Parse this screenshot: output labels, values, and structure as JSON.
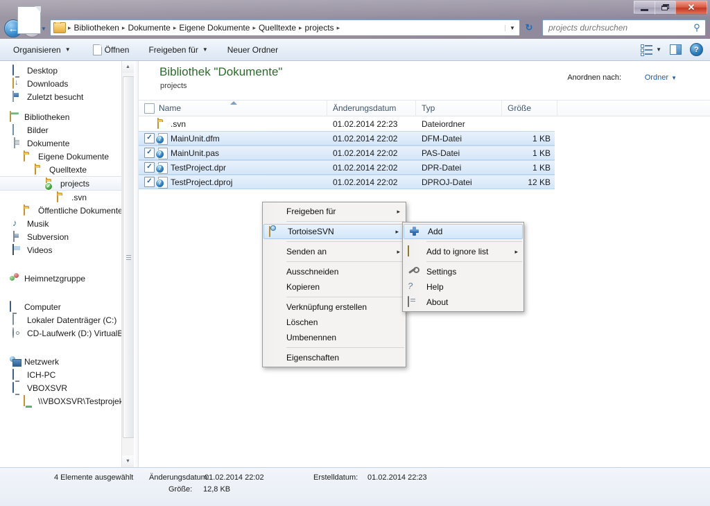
{
  "window": {
    "minimize_label": "Minimieren",
    "maximize_label": "Maximieren",
    "close_label": "Schließen"
  },
  "nav": {
    "back_glyph": "←",
    "forward_glyph": "→",
    "recent_caret": "▼",
    "breadcrumbs": [
      "Bibliotheken",
      "Dokumente",
      "Eigene Dokumente",
      "Quelltexte",
      "projects"
    ],
    "separator": "▸",
    "address_caret": "▼",
    "refresh_glyph": "↻"
  },
  "search": {
    "placeholder": "projects durchsuchen",
    "value": "",
    "icon_glyph": "⚲"
  },
  "toolbar": {
    "organize_label": "Organisieren",
    "open_label": "Öffnen",
    "share_label": "Freigeben für",
    "newfolder_label": "Neuer Ordner",
    "caret": "▼",
    "help_glyph": "?"
  },
  "sidebar": {
    "items": [
      {
        "label": "Desktop",
        "icon": "monitor-icon",
        "indent": 1
      },
      {
        "label": "Downloads",
        "icon": "downloads-icon",
        "indent": 1
      },
      {
        "label": "Zuletzt besucht",
        "icon": "recent-places-icon",
        "indent": 1
      },
      {
        "label": "Bibliotheken",
        "icon": "libraries-icon",
        "indent": 0
      },
      {
        "label": "Bilder",
        "icon": "pictures-icon",
        "indent": 1
      },
      {
        "label": "Dokumente",
        "icon": "documents-icon",
        "indent": 1
      },
      {
        "label": "Eigene Dokumente",
        "icon": "folder-icon",
        "indent": 2
      },
      {
        "label": "Quelltexte",
        "icon": "folder-icon",
        "indent": 3
      },
      {
        "label": "projects",
        "icon": "folder-svn-versioned-icon",
        "indent": 4,
        "selected": true
      },
      {
        "label": ".svn",
        "icon": "folder-icon",
        "indent": 5
      },
      {
        "label": "Öffentliche Dokumente",
        "icon": "folder-icon",
        "indent": 2
      },
      {
        "label": "Musik",
        "icon": "music-icon",
        "indent": 1
      },
      {
        "label": "Subversion",
        "icon": "subversion-icon",
        "indent": 1
      },
      {
        "label": "Videos",
        "icon": "videos-icon",
        "indent": 1
      },
      {
        "label": "Heimnetzgruppe",
        "icon": "homegroup-icon",
        "indent": 0
      },
      {
        "label": "Computer",
        "icon": "computer-icon",
        "indent": 0
      },
      {
        "label": "Lokaler Datenträger (C:)",
        "icon": "harddisk-icon",
        "indent": 1
      },
      {
        "label": "CD-Laufwerk (D:) VirtualBo",
        "icon": "cdrom-icon",
        "indent": 1
      },
      {
        "label": "Netzwerk",
        "icon": "network-icon",
        "indent": 0
      },
      {
        "label": "ICH-PC",
        "icon": "computer-icon",
        "indent": 1
      },
      {
        "label": "VBOXSVR",
        "icon": "computer-icon",
        "indent": 1
      },
      {
        "label": "\\\\VBOXSVR\\Testprojekt",
        "icon": "network-share-icon",
        "indent": 2
      }
    ]
  },
  "library": {
    "title": "Bibliothek \"Dokumente\"",
    "subtitle": "projects",
    "arrange_label": "Anordnen nach:",
    "arrange_value": "Ordner",
    "arrange_caret": "▼"
  },
  "columns": {
    "name": "Name",
    "date": "Änderungsdatum",
    "type": "Typ",
    "size": "Größe"
  },
  "files": [
    {
      "name": ".svn",
      "date": "01.02.2014 22:23",
      "type": "Dateiordner",
      "size": "",
      "icon": "folder-icon",
      "selected": false,
      "checked": false,
      "overlay": ""
    },
    {
      "name": "MainUnit.dfm",
      "date": "01.02.2014 22:02",
      "type": "DFM-Datei",
      "size": "1 KB",
      "icon": "file-icon",
      "selected": true,
      "checked": true,
      "overlay": "svn-unversioned-icon"
    },
    {
      "name": "MainUnit.pas",
      "date": "01.02.2014 22:02",
      "type": "PAS-Datei",
      "size": "1 KB",
      "icon": "file-icon",
      "selected": true,
      "checked": true,
      "overlay": "svn-unversioned-icon"
    },
    {
      "name": "TestProject.dpr",
      "date": "01.02.2014 22:02",
      "type": "DPR-Datei",
      "size": "1 KB",
      "icon": "file-icon",
      "selected": true,
      "checked": true,
      "overlay": "svn-unversioned-icon"
    },
    {
      "name": "TestProject.dproj",
      "date": "01.02.2014 22:02",
      "type": "DPROJ-Datei",
      "size": "12 KB",
      "icon": "file-icon",
      "selected": true,
      "checked": true,
      "overlay": "svn-unversioned-icon"
    }
  ],
  "context_menu": {
    "items": [
      {
        "label": "Freigeben für",
        "submenu": true,
        "icon": "",
        "highlighted": false,
        "divider_after": true
      },
      {
        "label": "TortoiseSVN",
        "submenu": true,
        "icon": "tortoisesvn-icon",
        "highlighted": true,
        "divider_after": true
      },
      {
        "label": "Senden an",
        "submenu": true,
        "icon": "",
        "highlighted": false,
        "divider_after": true
      },
      {
        "label": "Ausschneiden",
        "submenu": false,
        "icon": "",
        "highlighted": false,
        "divider_after": false
      },
      {
        "label": "Kopieren",
        "submenu": false,
        "icon": "",
        "highlighted": false,
        "divider_after": true
      },
      {
        "label": "Verknüpfung erstellen",
        "submenu": false,
        "icon": "",
        "highlighted": false,
        "divider_after": false
      },
      {
        "label": "Löschen",
        "submenu": false,
        "icon": "",
        "highlighted": false,
        "divider_after": false
      },
      {
        "label": "Umbenennen",
        "submenu": false,
        "icon": "",
        "highlighted": false,
        "divider_after": true
      },
      {
        "label": "Eigenschaften",
        "submenu": false,
        "icon": "",
        "highlighted": false,
        "divider_after": false
      }
    ],
    "arrow": "▸"
  },
  "submenu": {
    "items": [
      {
        "label": "Add",
        "submenu": false,
        "icon": "add-icon",
        "highlighted": true,
        "divider_after": true
      },
      {
        "label": "Add to ignore list",
        "submenu": true,
        "icon": "ignore-icon",
        "highlighted": false,
        "divider_after": true
      },
      {
        "label": "Settings",
        "submenu": false,
        "icon": "settings-icon",
        "highlighted": false,
        "divider_after": false
      },
      {
        "label": "Help",
        "submenu": false,
        "icon": "help-icon",
        "highlighted": false,
        "divider_after": false
      },
      {
        "label": "About",
        "submenu": false,
        "icon": "about-icon",
        "highlighted": false,
        "divider_after": false
      }
    ],
    "arrow": "▸"
  },
  "statusbar": {
    "count": "4 Elemente ausgewählt",
    "modified_label": "Änderungsdatum:",
    "modified_value": "01.02.2014 22:02",
    "created_label": "Erstelldatum:",
    "created_value": "01.02.2014 22:23",
    "size_label": "Größe:",
    "size_value": "12,8 KB"
  },
  "colors": {
    "accent": "#1c5fa8",
    "library_title": "#2c6b2c",
    "selection": "#d4e6f8",
    "close_button": "#c03a25"
  }
}
